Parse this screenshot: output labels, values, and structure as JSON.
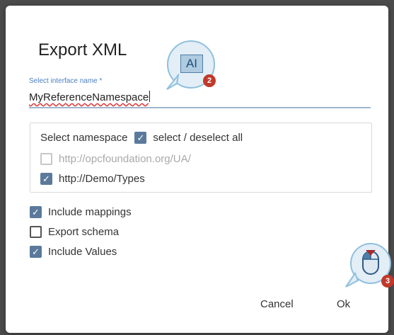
{
  "dialog": {
    "title": "Export XML",
    "interface_field": {
      "label": "Select interface name *",
      "value": "MyReferenceNamespace"
    },
    "namespace_section": {
      "label": "Select namespace",
      "select_all_label": "select / deselect all",
      "select_all_checked": true,
      "items": [
        {
          "label": "http://opcfoundation.org/UA/",
          "checked": false,
          "disabled": true
        },
        {
          "label": "http://Demo/Types",
          "checked": true,
          "disabled": false
        }
      ]
    },
    "options": [
      {
        "label": "Include mappings",
        "checked": true
      },
      {
        "label": "Export schema",
        "checked": false
      },
      {
        "label": "Include Values",
        "checked": true
      }
    ],
    "buttons": {
      "cancel_label": "Cancel",
      "ok_label": "Ok"
    }
  },
  "annotations": {
    "text_callout": {
      "icon_text": "AI",
      "badge": "2",
      "icon": "text-input-icon"
    },
    "mouse_callout": {
      "badge": "3",
      "icon": "mouse-left-click-icon"
    }
  },
  "colors": {
    "checkbox": "#5b7a9b",
    "label_accent": "#4a7fc0",
    "badge": "#c0392b"
  }
}
